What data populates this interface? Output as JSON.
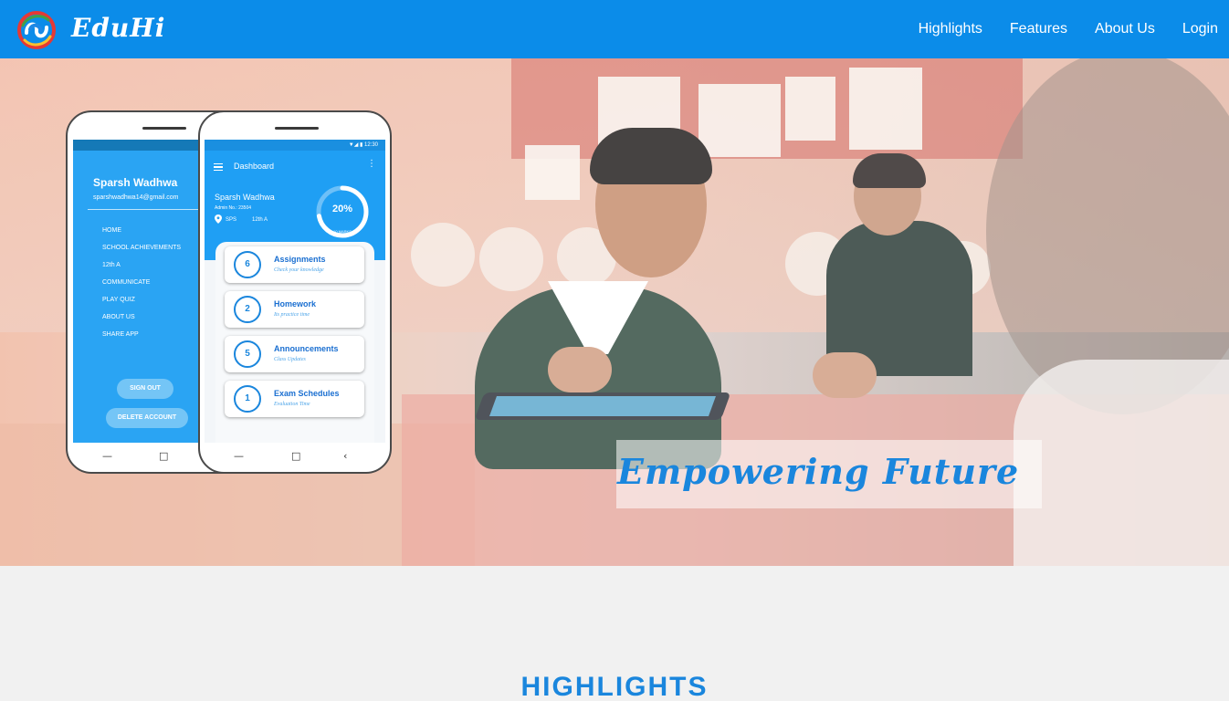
{
  "nav": {
    "brand": "EduHi",
    "links": [
      "Highlights",
      "Features",
      "About Us",
      "Login"
    ]
  },
  "hero": {
    "tagline": "Empowering Future"
  },
  "drawer": {
    "name": "Sparsh Wadhwa",
    "email": "sparshwadhwa14@gmail.com",
    "menu": [
      "HOME",
      "SCHOOL ACHIEVEMENTS",
      "12th A",
      "COMMUNICATE",
      "PLAY QUIZ",
      "ABOUT US",
      "SHARE APP"
    ],
    "sign_out": "SIGN OUT",
    "delete_account": "DELETE ACCOUNT"
  },
  "dashboard": {
    "status_time": "12:30",
    "title": "Dashboard",
    "name": "Sparsh Wadhwa",
    "admission": "Admin No.: 23504",
    "school": "SPS",
    "class": "12th A",
    "progress_label": "20%",
    "progress_value": 0.2,
    "progress_sub": "10 MARKS",
    "tiles": [
      {
        "count": "6",
        "title": "Assignments",
        "subtitle": "Check your knowledge"
      },
      {
        "count": "2",
        "title": "Homework",
        "subtitle": "Its practice time"
      },
      {
        "count": "5",
        "title": "Announcements",
        "subtitle": "Class Updates"
      },
      {
        "count": "1",
        "title": "Exam Schedules",
        "subtitle": "Evaluation Time"
      }
    ]
  },
  "section": {
    "highlights_title": "HIGHLIGHTS"
  },
  "colors": {
    "nav_bg": "#0b8ce9",
    "accent": "#1a86dd",
    "page_bg": "#f1f1f1"
  }
}
